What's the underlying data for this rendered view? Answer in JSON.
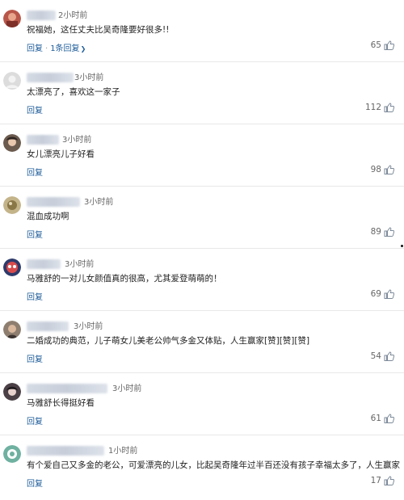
{
  "comments": [
    {
      "time": "2小时前",
      "text": "祝福她，这任丈夫比吴奇隆要好很多!!",
      "reply": "回复",
      "replies": "1条回复",
      "likes": "65"
    },
    {
      "time": "3小时前",
      "text": "太漂亮了，喜欢这一家子",
      "reply": "回复",
      "likes": "112"
    },
    {
      "time": "3小时前",
      "text": "女儿漂亮儿子好看",
      "reply": "回复",
      "likes": "98"
    },
    {
      "time": "3小时前",
      "text": "混血成功啊",
      "reply": "回复",
      "likes": "89"
    },
    {
      "time": "3小时前",
      "text": "马雅舒的一对儿女颜值真的很高，尤其爱登萌萌的！",
      "reply": "回复",
      "likes": "69"
    },
    {
      "time": "3小时前",
      "text": "二婚成功的典范，儿子萌女儿美老公帅气多金又体贴，人生赢家[赞][赞][赞]",
      "reply": "回复",
      "likes": "54"
    },
    {
      "time": "3小时前",
      "text": "马雅舒长得挺好看",
      "reply": "回复",
      "likes": "61"
    },
    {
      "time": "1小时前",
      "text": "有个爱自己又多金的老公，可爱漂亮的儿女，比起吴奇隆年过半百还没有孩子幸福太多了，人生赢家",
      "reply": "回复",
      "likes": "17"
    }
  ],
  "colors": {
    "link": "#1e5c9a",
    "divider": "#e8e8e8",
    "text": "#222222"
  }
}
